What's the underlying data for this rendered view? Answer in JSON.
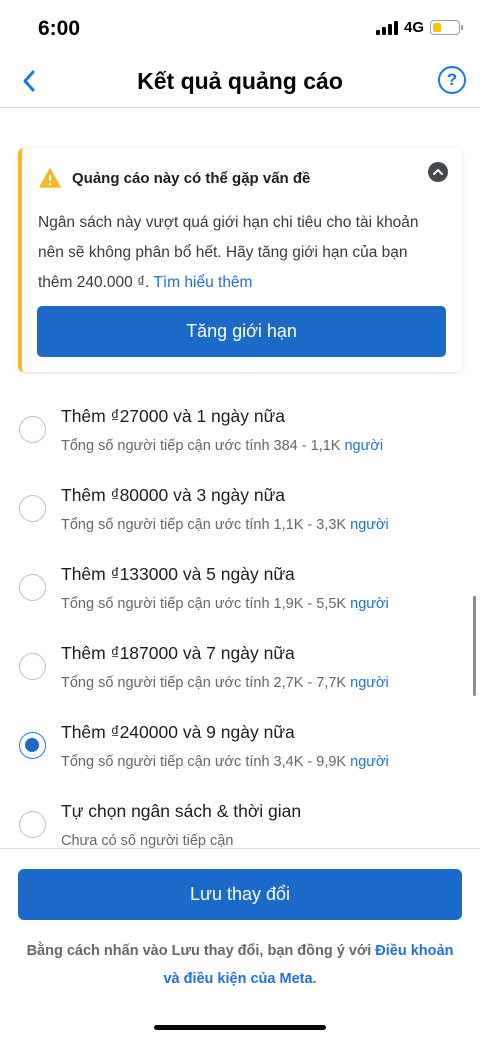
{
  "status": {
    "time": "6:00",
    "network": "4G"
  },
  "nav": {
    "title": "Kết quả quảng cáo",
    "help": "?"
  },
  "warning": {
    "title": "Quảng cáo này có thể gặp vấn đề",
    "body_line1": "Ngân sách này vượt quá giới hạn chi tiêu cho tài khoản",
    "body_line2": "nên sẽ không phân bổ hết. Hãy tăng giới hạn của bạn",
    "body_line3": "thêm 240.000 ₫.",
    "link": "Tìm hiểu thêm",
    "button": "Tăng giới hạn",
    "accent_color": "#f7b928"
  },
  "options": [
    {
      "title": "Thêm ₫27000 và 1 ngày nữa",
      "sub": "Tổng số người tiếp cận ước tính 384 - 1,1K",
      "link": "người",
      "selected": false
    },
    {
      "title": "Thêm ₫80000 và 3 ngày nữa",
      "sub": "Tổng số người tiếp cận ước tính 1,1K - 3,3K",
      "link": "người",
      "selected": false
    },
    {
      "title": "Thêm ₫133000 và 5 ngày nữa",
      "sub": "Tổng số người tiếp cận ước tính 1,9K - 5,5K",
      "link": "người",
      "selected": false
    },
    {
      "title": "Thêm ₫187000 và 7 ngày nữa",
      "sub": "Tổng số người tiếp cận ước tính 2,7K - 7,7K",
      "link": "người",
      "selected": false
    },
    {
      "title": "Thêm ₫240000 và 9 ngày nữa",
      "sub": "Tổng số người tiếp cận ước tính 3,4K - 9,9K",
      "link": "người",
      "selected": true
    },
    {
      "title": "Tự chọn ngân sách & thời gian",
      "sub": "Chưa có số người tiếp cận",
      "link": "",
      "selected": false
    }
  ],
  "footer": {
    "save_button": "Lưu thay đổi",
    "terms_text": "Bằng cách nhấn vào Lưu thay đổi, bạn đồng ý với",
    "terms_link1": "Điều khoản",
    "terms_link2": "và điều kiện của Meta",
    "terms_end": "."
  },
  "colors": {
    "primary": "#1b6ac9",
    "link": "#216fdb",
    "warning": "#f7b928"
  }
}
